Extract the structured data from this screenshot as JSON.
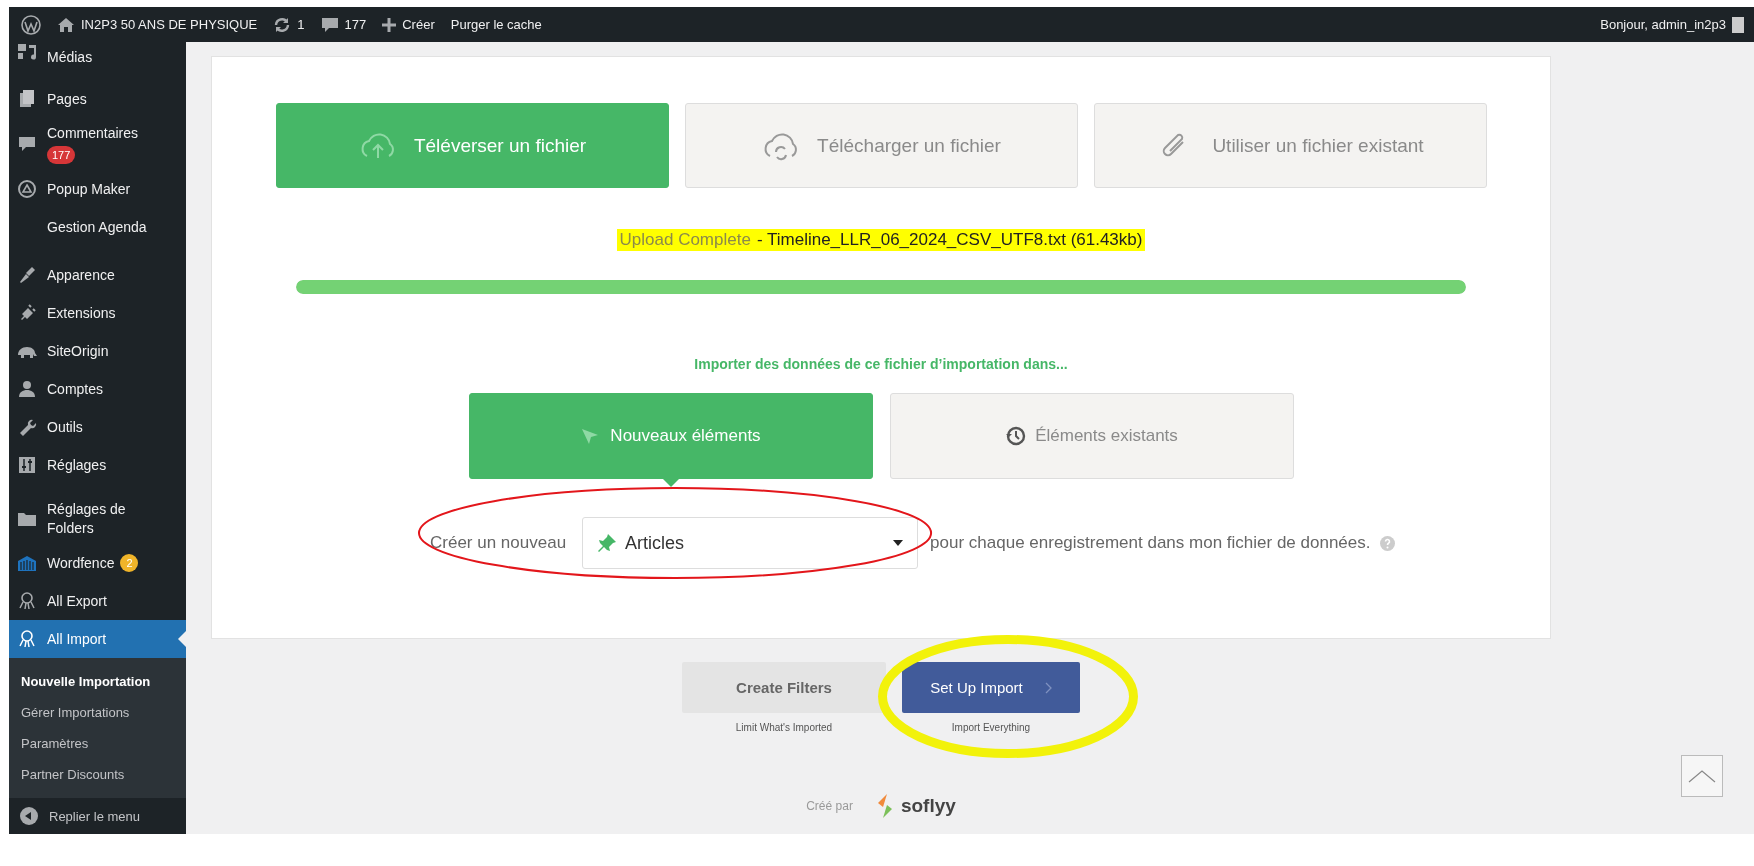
{
  "top_bar": {
    "site_title": "IN2P3 50 ANS DE PHYSIQUE",
    "updates_count": "1",
    "comments_count": "177",
    "new_label": "Créer",
    "purge_label": "Purger le cache",
    "greeting": "Bonjour, admin_in2p3"
  },
  "sidebar": {
    "groups": [
      [
        {
          "label": "Médias",
          "selected": false
        },
        {
          "label": "Pages",
          "selected": false
        },
        {
          "label": "Commentaires",
          "selected": false,
          "badge": {
            "text": "177",
            "color": "#d63638"
          }
        },
        {
          "label": "Popup Maker",
          "selected": false
        },
        {
          "label": "Gestion Agenda",
          "selected": false
        }
      ],
      [
        {
          "label": "Apparence",
          "selected": false
        },
        {
          "label": "Extensions",
          "selected": false
        },
        {
          "label": "SiteOrigin",
          "selected": false
        },
        {
          "label": "Comptes",
          "selected": false
        },
        {
          "label": "Outils",
          "selected": false
        },
        {
          "label": "Réglages",
          "selected": false
        }
      ],
      [
        {
          "label": "Réglages de Folders",
          "selected": false
        },
        {
          "label": "Wordfence",
          "selected": false,
          "badge": {
            "text": "2",
            "color": "#f0b429"
          }
        },
        {
          "label": "All Export",
          "selected": false
        },
        {
          "label": "All Import",
          "selected": true,
          "children": [
            {
              "label": "Nouvelle Importation",
              "selected": true
            },
            {
              "label": "Gérer Importations",
              "selected": false
            },
            {
              "label": "Paramètres",
              "selected": false
            },
            {
              "label": "Partner Discounts",
              "selected": false
            }
          ]
        }
      ]
    ],
    "collapse_label": "Replier le menu"
  },
  "importer": {
    "source_tabs": [
      {
        "label": "Téléverser un fichier",
        "selected": true
      },
      {
        "label": "Télécharger un fichier",
        "selected": false
      },
      {
        "label": "Utiliser un fichier existant",
        "selected": false
      }
    ],
    "upload_status": {
      "label": "Upload Complete",
      "file": "- Timeline_LLR_06_2024_CSV_UTF8.txt (61.43kb)",
      "highlighted": true
    },
    "progress": {
      "level": 1
    },
    "target_prompt": "Importer des données de ce fichier d’importation dans...",
    "target_tabs": [
      {
        "label": "Nouveaux éléments",
        "selected": true
      },
      {
        "label": "Éléments existants",
        "selected": false
      }
    ],
    "create_row": {
      "prefix": "Créer un nouveau",
      "post_type": "Articles",
      "suffix": "pour chaque enregistrement dans mon fichier de données."
    }
  },
  "actions": [
    {
      "kind": "secondary",
      "label": "Create Filters",
      "caption": "Limit What's Imported"
    },
    {
      "kind": "primary",
      "label": "Set Up Import",
      "caption": "Import Everything"
    }
  ],
  "footer": {
    "prefix": "Créé par",
    "brand": "soflyy"
  },
  "annotations": [
    {
      "kind": "ellipse",
      "color": "#e3161b"
    },
    {
      "kind": "ellipse",
      "color": "#f2f20a"
    }
  ]
}
